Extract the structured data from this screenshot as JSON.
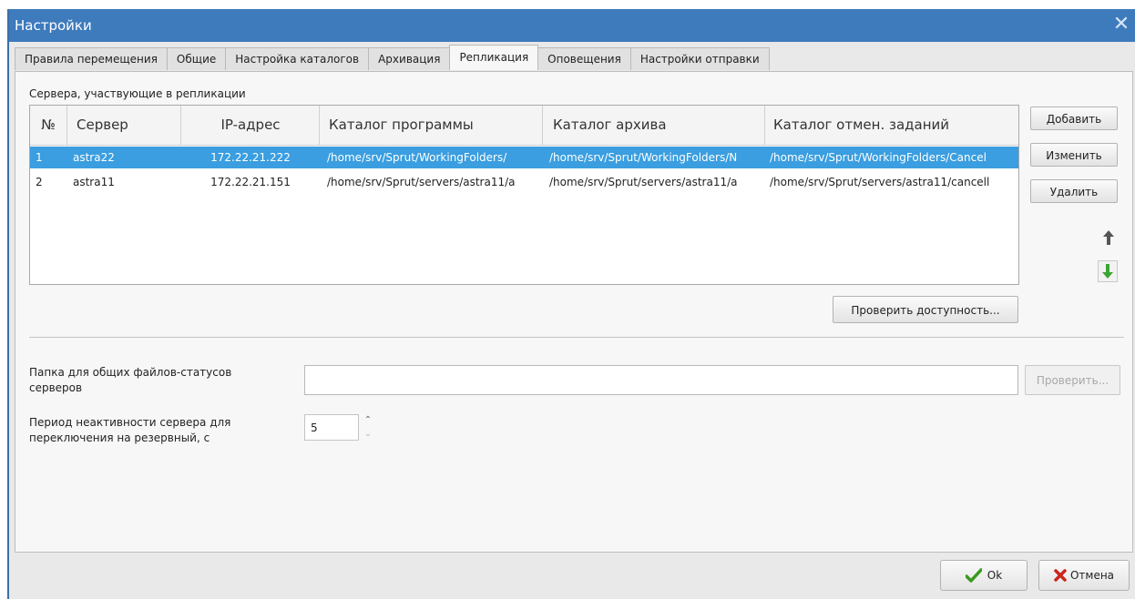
{
  "window": {
    "title": "Настройки",
    "close_icon": "close-icon"
  },
  "tabs": [
    {
      "label": "Правила перемещения"
    },
    {
      "label": "Общие"
    },
    {
      "label": "Настройка каталогов"
    },
    {
      "label": "Архивация"
    },
    {
      "label": "Репликация",
      "active": true
    },
    {
      "label": "Оповещения"
    },
    {
      "label": "Настройки отправки"
    }
  ],
  "replication": {
    "section_label": "Сервера, участвующие в репликации",
    "columns": [
      "№",
      "Сервер",
      "IP-адрес",
      "Каталог программы",
      "Каталог архива",
      "Каталог отмен. заданий"
    ],
    "rows": [
      {
        "num": "1",
        "server": "astra22",
        "ip": "172.22.21.222",
        "program_dir": "/home/srv/Sprut/WorkingFolders/",
        "archive_dir": "/home/srv/Sprut/WorkingFolders/N",
        "cancel_dir": "/home/srv/Sprut/WorkingFolders/Cancel",
        "selected": true
      },
      {
        "num": "2",
        "server": "astra11",
        "ip": "172.22.21.151",
        "program_dir": "/home/srv/Sprut/servers/astra11/a",
        "archive_dir": "/home/srv/Sprut/servers/astra11/a",
        "cancel_dir": "/home/srv/Sprut/servers/astra11/cancell",
        "selected": false
      }
    ],
    "buttons": {
      "add": "Добавить",
      "edit": "Изменить",
      "delete": "Удалить",
      "check": "Проверить доступность..."
    },
    "move_up_icon": "arrow-up-icon",
    "move_down_icon": "arrow-down-icon"
  },
  "status_folder": {
    "label_line1": "Папка для общих  файлов-статусов",
    "label_line2": "серверов",
    "value": "",
    "check_button": "Проверить..."
  },
  "inactivity": {
    "label_line1": "Период неактивности сервера для",
    "label_line2": "переключения на резервный, с",
    "value": "5"
  },
  "footer": {
    "ok": "Ok",
    "cancel": "Отмена"
  },
  "colors": {
    "titlebar": "#3e7bbd",
    "selection": "#3a9ee0",
    "ok_check": "#3a9a1f",
    "cancel_x": "#c8261c",
    "arrow_up": "#555555",
    "arrow_down": "#3aa534"
  }
}
